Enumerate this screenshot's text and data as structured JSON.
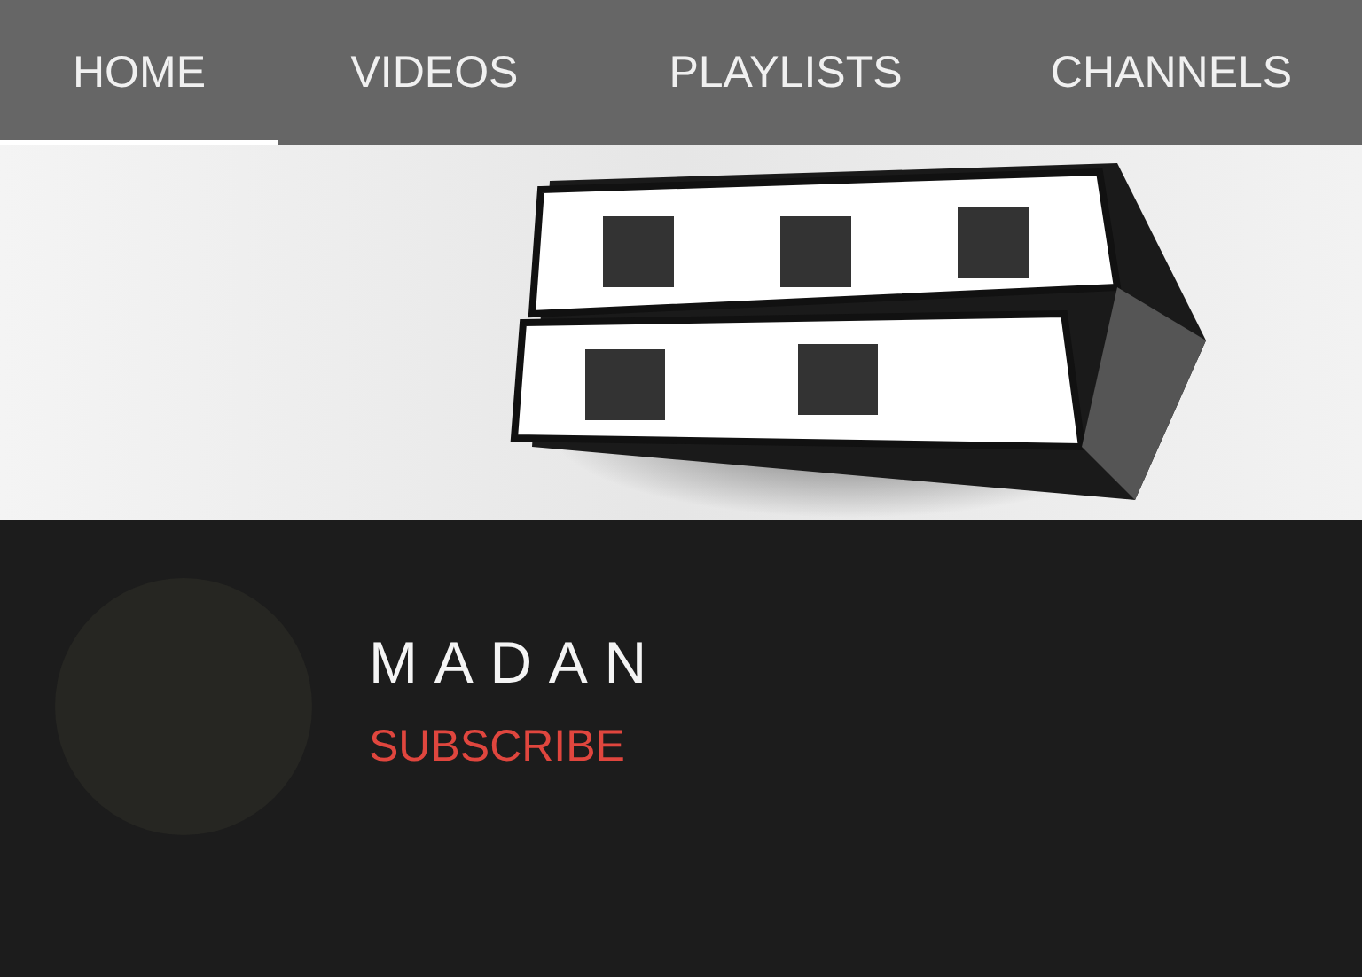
{
  "tabs": [
    {
      "label": "HOME",
      "selected": true
    },
    {
      "label": "VIDEOS",
      "selected": false
    },
    {
      "label": "PLAYLISTS",
      "selected": false
    },
    {
      "label": "CHANNELS",
      "selected": false
    }
  ],
  "channel": {
    "name": "M A D A N",
    "subscribe": "SUBSCRIBE"
  }
}
